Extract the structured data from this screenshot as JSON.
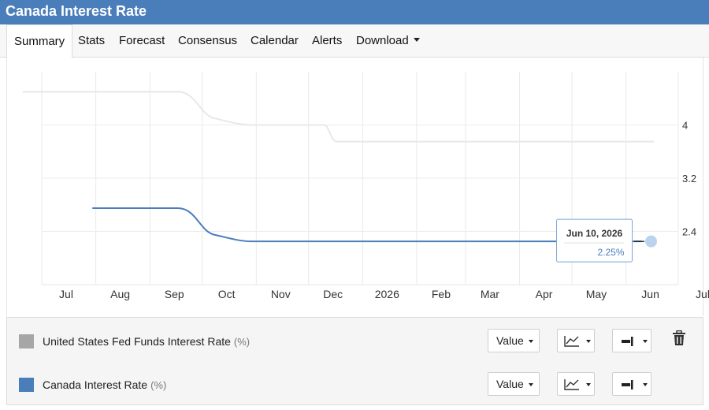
{
  "header": {
    "title": "Canada Interest Rate"
  },
  "tabs": [
    {
      "label": "Summary",
      "active": true
    },
    {
      "label": "Stats"
    },
    {
      "label": "Forecast"
    },
    {
      "label": "Consensus"
    },
    {
      "label": "Calendar"
    },
    {
      "label": "Alerts"
    },
    {
      "label": "Download",
      "has_dropdown": true
    }
  ],
  "chart_data": {
    "type": "line",
    "x_type": "date",
    "x_ticks": [
      "Jul",
      "Aug",
      "Sep",
      "Oct",
      "Nov",
      "Dec",
      "2026",
      "Feb",
      "Mar",
      "Apr",
      "May",
      "Jun",
      "Jul"
    ],
    "x_range": [
      "2025-07-01",
      "2026-07-01"
    ],
    "y_ticks": [
      2.4,
      3.2,
      4
    ],
    "ylim": [
      1.6,
      4.8
    ],
    "y_axis_side": "right",
    "grid": true,
    "series": [
      {
        "name": "United States Fed Funds Interest Rate",
        "unit": "%",
        "color": "#e8e8e8",
        "points": [
          {
            "x": "2025-06-20",
            "y": 4.5
          },
          {
            "x": "2025-09-17",
            "y": 4.5
          },
          {
            "x": "2025-10-29",
            "y": 4.0
          },
          {
            "x": "2025-12-10",
            "y": 4.0
          },
          {
            "x": "2025-12-10",
            "y": 3.75
          },
          {
            "x": "2026-06-17",
            "y": 3.75
          }
        ]
      },
      {
        "name": "Canada Interest Rate",
        "unit": "%",
        "color": "#4a7ebb",
        "points": [
          {
            "x": "2025-07-30",
            "y": 2.75
          },
          {
            "x": "2025-09-17",
            "y": 2.75
          },
          {
            "x": "2025-10-29",
            "y": 2.25
          },
          {
            "x": "2026-06-10",
            "y": 2.25
          }
        ]
      }
    ],
    "tooltip": {
      "date": "Jun 10, 2026",
      "value": "2.25%"
    }
  },
  "legend": {
    "rows": [
      {
        "name": "United States Fed Funds Interest Rate",
        "unit": "(%)",
        "color": "#a6a6a6",
        "value_label": "Value",
        "deletable": true
      },
      {
        "name": "Canada Interest Rate",
        "unit": "(%)",
        "color": "#4a7ebb",
        "value_label": "Value",
        "deletable": false
      }
    ]
  }
}
